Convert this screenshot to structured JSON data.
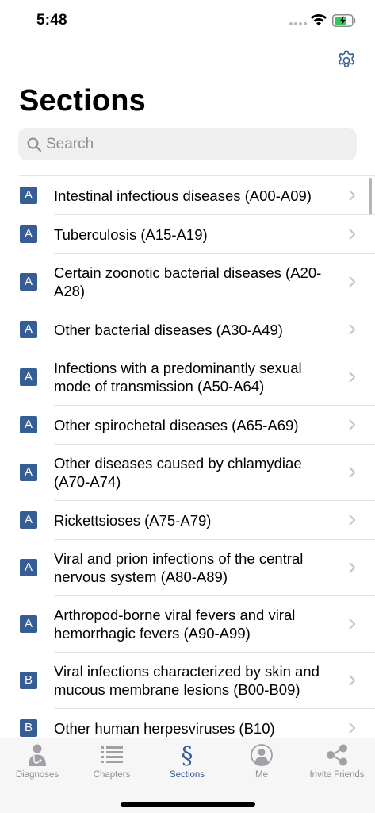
{
  "status_bar": {
    "time": "5:48"
  },
  "header": {
    "title": "Sections"
  },
  "search": {
    "placeholder": "Search",
    "value": ""
  },
  "colors": {
    "accent": "#365d94",
    "badge_text": "#ffffff",
    "inactive": "#8e8e93"
  },
  "sections": [
    {
      "badge": "A",
      "label": "Intestinal infectious diseases (A00-A09)"
    },
    {
      "badge": "A",
      "label": "Tuberculosis (A15-A19)"
    },
    {
      "badge": "A",
      "label": "Certain zoonotic bacterial diseases (A20-A28)"
    },
    {
      "badge": "A",
      "label": "Other bacterial diseases (A30-A49)"
    },
    {
      "badge": "A",
      "label": "Infections with a predominantly sexual mode of transmission (A50-A64)"
    },
    {
      "badge": "A",
      "label": "Other spirochetal diseases (A65-A69)"
    },
    {
      "badge": "A",
      "label": "Other diseases caused by chlamydiae (A70-A74)"
    },
    {
      "badge": "A",
      "label": "Rickettsioses (A75-A79)"
    },
    {
      "badge": "A",
      "label": "Viral and prion infections of the central nervous system (A80-A89)"
    },
    {
      "badge": "A",
      "label": "Arthropod-borne viral fevers and viral hemorrhagic fevers (A90-A99)"
    },
    {
      "badge": "B",
      "label": "Viral infections characterized by skin and mucous membrane lesions (B00-B09)"
    },
    {
      "badge": "B",
      "label": "Other human herpesviruses (B10)"
    }
  ],
  "tabs": [
    {
      "label": "Diagnoses",
      "icon": "doctor-icon",
      "active": false
    },
    {
      "label": "Chapters",
      "icon": "list-icon",
      "active": false
    },
    {
      "label": "Sections",
      "icon": "section-sign-icon",
      "active": true
    },
    {
      "label": "Me",
      "icon": "person-icon",
      "active": false
    },
    {
      "label": "Invite Friends",
      "icon": "share-icon",
      "active": false
    }
  ]
}
